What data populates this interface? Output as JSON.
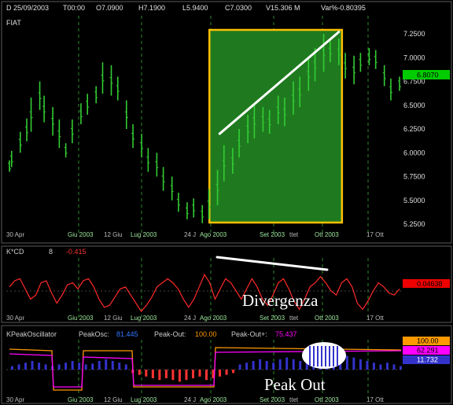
{
  "header": {
    "symbol": "FIAT",
    "date": "D 25/09/2003",
    "time": "T00:00",
    "open": "O7.0900",
    "high": "H7.1900",
    "low": "L5.9400",
    "close": "C7.0300",
    "volume": "V15.306 M",
    "var": "Var%-0.80395"
  },
  "colors": {
    "background": "#000000",
    "candles": "#33cc33",
    "grid": "#2a8a2a",
    "highlight_fill": "#1f7a1f",
    "highlight_border": "#ffbf00",
    "trendline": "#ffffff",
    "indicator_line": "#ff2a2a",
    "last_price_badge": "#00cc00",
    "kcd_badge": "#ee0000",
    "peak_in_bars": "#3333cc",
    "peak_out_bars": "#ff3333",
    "peak_in_line": "#ff00ff",
    "peak_out_line": "#ff9900"
  },
  "price_panel": {
    "last_price": "6.8070",
    "y_ticks": [
      "7.2500",
      "7.0000",
      "6.7500",
      "6.5000",
      "6.2500",
      "6.0000",
      "5.7500",
      "5.5000",
      "5.2500"
    ],
    "x_ticks": [
      "30 Apr",
      "Giu 2003",
      "12 Giu",
      "Lug 2003",
      "24 J",
      "Ago 2003",
      "Set 2003",
      "ttet",
      "Ott 2003",
      "17 Ott"
    ]
  },
  "kcd_panel": {
    "label": "K*CD",
    "period": "8",
    "value": "-0.415",
    "last_value": "0.04638",
    "annotation": "Divergenza",
    "x_ticks": [
      "30 Apr",
      "Giu 2003",
      "12 Giu",
      "Lug 2003",
      "24 J",
      "Ago 2003",
      "Set 2003",
      "ttet",
      "Ott 2003",
      "17 Ott"
    ]
  },
  "peak_panel": {
    "label": "KPeakOscillator",
    "peak_osc_label": "PeakOsc:",
    "peak_osc_value": "81.445",
    "peak_out_label": "Peak-Out:",
    "peak_out_value": "100.00",
    "peak_outs_label": "Peak-Out+:",
    "peak_outs_value": "75.437",
    "badge_top": "100.00",
    "badge_mid": "62.291",
    "badge_bottom": "11.732",
    "annotation": "Peak Out",
    "x_ticks": [
      "30 Apr",
      "Giu 2003",
      "12 Giu",
      "Lug 2003",
      "24 J",
      "Ago 2003",
      "Set 2003",
      "ttet",
      "Ott 2003",
      "17 Ott"
    ]
  },
  "chart_data": {
    "type": "candlestick",
    "title": "FIAT",
    "y_axis": {
      "min": 5.25,
      "max": 7.25,
      "side": "right"
    },
    "grid": true,
    "highlight_region": {
      "from_date": "2003-08-01",
      "to_date": "2003-09-29"
    },
    "price_series": [
      {
        "date": "2003-04-30",
        "high": 5.92,
        "low": 5.8
      },
      {
        "date": "2003-05-01",
        "high": 6.02,
        "low": 5.85
      },
      {
        "date": "2003-05-05",
        "high": 6.22,
        "low": 6.0
      },
      {
        "date": "2003-05-08",
        "high": 6.36,
        "low": 6.12
      },
      {
        "date": "2003-05-10",
        "high": 6.58,
        "low": 6.22
      },
      {
        "date": "2003-05-14",
        "high": 6.75,
        "low": 6.45
      },
      {
        "date": "2003-05-16",
        "high": 6.6,
        "low": 6.32
      },
      {
        "date": "2003-05-20",
        "high": 6.48,
        "low": 6.18
      },
      {
        "date": "2003-05-23",
        "high": 6.35,
        "low": 6.05
      },
      {
        "date": "2003-05-26",
        "high": 6.1,
        "low": 5.95
      },
      {
        "date": "2003-05-29",
        "high": 6.35,
        "low": 6.1
      },
      {
        "date": "2003-06-02",
        "high": 6.52,
        "low": 6.3
      },
      {
        "date": "2003-06-05",
        "high": 6.62,
        "low": 6.4
      },
      {
        "date": "2003-06-09",
        "high": 6.7,
        "low": 6.52
      },
      {
        "date": "2003-06-12",
        "high": 6.95,
        "low": 6.62
      },
      {
        "date": "2003-06-16",
        "high": 6.92,
        "low": 6.6
      },
      {
        "date": "2003-06-19",
        "high": 6.8,
        "low": 6.55
      },
      {
        "date": "2003-06-23",
        "high": 6.55,
        "low": 6.25
      },
      {
        "date": "2003-06-26",
        "high": 6.3,
        "low": 6.05
      },
      {
        "date": "2003-06-30",
        "high": 6.2,
        "low": 5.95
      },
      {
        "date": "2003-07-03",
        "high": 6.05,
        "low": 5.8
      },
      {
        "date": "2003-07-07",
        "high": 6.0,
        "low": 5.75
      },
      {
        "date": "2003-07-10",
        "high": 5.85,
        "low": 5.6
      },
      {
        "date": "2003-07-14",
        "high": 5.75,
        "low": 5.5
      },
      {
        "date": "2003-07-17",
        "high": 5.58,
        "low": 5.38
      },
      {
        "date": "2003-07-21",
        "high": 5.48,
        "low": 5.3
      },
      {
        "date": "2003-07-24",
        "high": 5.52,
        "low": 5.32
      },
      {
        "date": "2003-07-28",
        "high": 5.45,
        "low": 5.26
      },
      {
        "date": "2003-07-31",
        "high": 5.62,
        "low": 5.3
      },
      {
        "date": "2003-08-04",
        "high": 5.82,
        "low": 5.45
      },
      {
        "date": "2003-08-07",
        "high": 6.08,
        "low": 5.7
      },
      {
        "date": "2003-08-11",
        "high": 6.05,
        "low": 5.78
      },
      {
        "date": "2003-08-14",
        "high": 6.25,
        "low": 5.95
      },
      {
        "date": "2003-08-18",
        "high": 6.4,
        "low": 6.1
      },
      {
        "date": "2003-08-21",
        "high": 6.52,
        "low": 6.15
      },
      {
        "date": "2003-08-25",
        "high": 6.48,
        "low": 6.22
      },
      {
        "date": "2003-08-28",
        "high": 6.45,
        "low": 6.2
      },
      {
        "date": "2003-09-01",
        "high": 6.6,
        "low": 6.3
      },
      {
        "date": "2003-09-04",
        "high": 6.58,
        "low": 6.28
      },
      {
        "date": "2003-09-08",
        "high": 6.75,
        "low": 6.4
      },
      {
        "date": "2003-09-11",
        "high": 6.8,
        "low": 6.48
      },
      {
        "date": "2003-09-15",
        "high": 7.0,
        "low": 6.65
      },
      {
        "date": "2003-09-18",
        "high": 7.1,
        "low": 6.75
      },
      {
        "date": "2003-09-22",
        "high": 7.25,
        "low": 6.85
      },
      {
        "date": "2003-09-25",
        "high": 7.19,
        "low": 6.95
      },
      {
        "date": "2003-09-29",
        "high": 7.2,
        "low": 6.92
      },
      {
        "date": "2003-10-02",
        "high": 7.05,
        "low": 6.78
      },
      {
        "date": "2003-10-06",
        "high": 7.02,
        "low": 6.72
      },
      {
        "date": "2003-10-09",
        "high": 7.05,
        "low": 6.85
      },
      {
        "date": "2003-10-13",
        "high": 7.1,
        "low": 6.92
      },
      {
        "date": "2003-10-16",
        "high": 7.08,
        "low": 6.88
      },
      {
        "date": "2003-10-20",
        "high": 6.92,
        "low": 6.7
      },
      {
        "date": "2003-10-23",
        "high": 6.78,
        "low": 6.55
      },
      {
        "date": "2003-10-27",
        "high": 6.8,
        "low": 6.65
      }
    ],
    "trendline": {
      "from": {
        "date": "2003-08-05",
        "value": 6.2
      },
      "to": {
        "date": "2003-09-29",
        "value": 7.27
      }
    },
    "kcd_series": [
      0.1,
      0.25,
      0.3,
      0.05,
      -0.2,
      -0.1,
      0.2,
      0.25,
      -0.05,
      -0.3,
      -0.1,
      0.15,
      0.2,
      0.05,
      0.25,
      0.3,
      0.1,
      -0.2,
      -0.4,
      -0.35,
      -0.15,
      0.05,
      0.1,
      -0.1,
      -0.3,
      -0.5,
      -0.35,
      -0.15,
      0.1,
      0.2,
      0.3,
      0.2,
      0.05,
      -0.2,
      -0.4,
      -0.2,
      0.1,
      0.4,
      0.2,
      -0.2,
      0.05,
      0.3,
      0.2,
      0.0,
      -0.2,
      0.05,
      0.3,
      0.1,
      -0.2,
      -0.35,
      -0.1,
      0.2,
      0.3,
      0.05,
      -0.25,
      -0.45,
      -0.2,
      0.1,
      0.2,
      0.35,
      0.2,
      0.0,
      -0.1,
      0.2,
      0.3,
      0.1,
      -0.3,
      -0.45,
      -0.25,
      0.0,
      0.2,
      0.1,
      -0.05,
      -0.1,
      0.05
    ],
    "peak_osc_bars": [
      0.2,
      0.3,
      0.4,
      0.5,
      0.4,
      0.3,
      0.2,
      0.3,
      0.4,
      0.5,
      0.4,
      0.3,
      0.35,
      0.5,
      0.6,
      0.5,
      0.4,
      0.3,
      -0.2,
      -0.3,
      -0.4,
      -0.5,
      -0.6,
      -0.5,
      -0.6,
      -0.7,
      -0.6,
      -0.5,
      -0.4,
      -0.6,
      -0.5,
      -0.4,
      -0.3,
      -0.2,
      0.3,
      0.4,
      0.5,
      0.6,
      0.5,
      0.4,
      0.6,
      0.7,
      0.6,
      0.5,
      0.6,
      0.7,
      0.8,
      0.9,
      1.0,
      0.9,
      0.8,
      0.7,
      0.6,
      0.5,
      0.4,
      0.3,
      0.4,
      0.3,
      0.2
    ]
  }
}
